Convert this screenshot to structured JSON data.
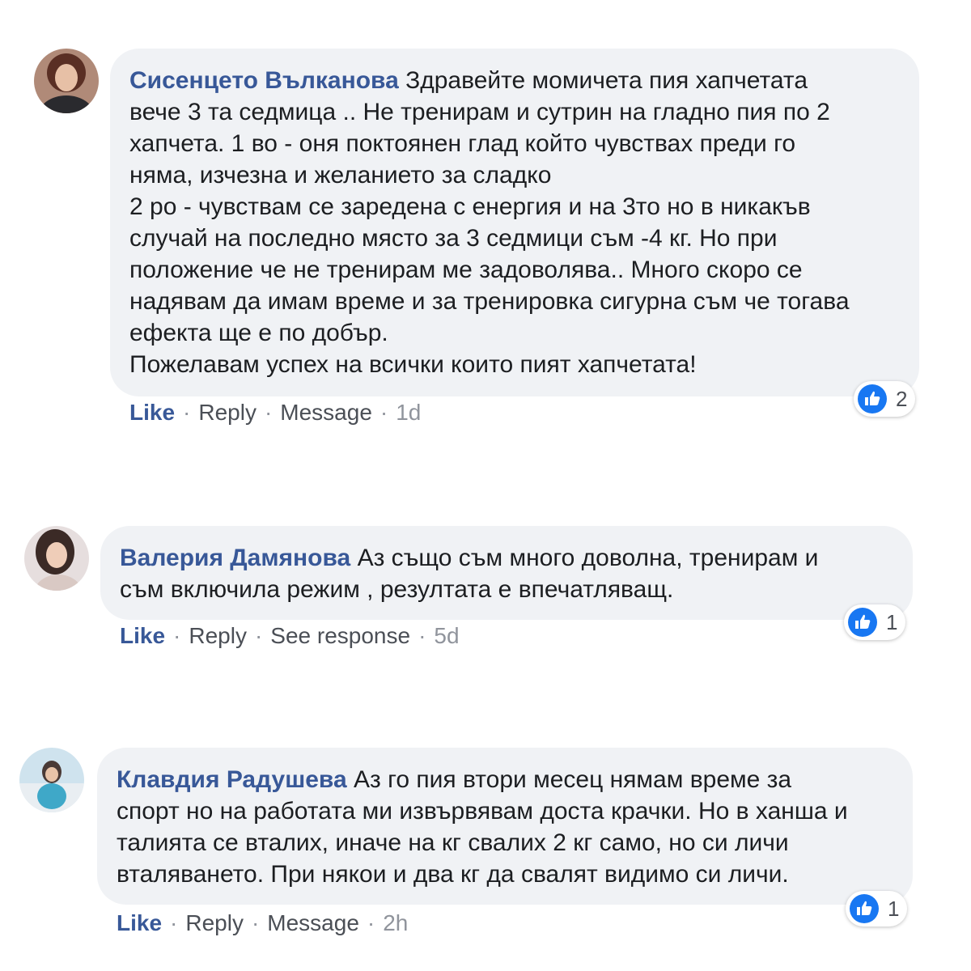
{
  "colors": {
    "author": "#385898",
    "bubble": "#f0f2f5",
    "like_blue": "#1877f2"
  },
  "comments": [
    {
      "author": "Сисенцето Вълканова",
      "lines": [
        " Здравейте момичета пия хапчетата",
        "вече 3 та седмица .. Не тренирам и сутрин на гладно пия по 2",
        "хапчета. 1 во - оня поктоянен глад който чувствах преди го",
        "няма, изчезна и желанието за сладко",
        "2 ро - чувствам се заредена с енергия и на 3то но в никакъв",
        "случай на последно място за 3 седмици съм -4 кг. Но при",
        "положение че не тренирам ме задоволява.. Много скоро се",
        "надявам да имам време и за тренировка сигурна съм че тогава",
        "ефекта ще е по добър.",
        "Пожелавам успех на всички които пият хапчетата!"
      ],
      "actions": {
        "like": "Like",
        "reply": "Reply",
        "extra": "Message",
        "time": "1d"
      },
      "reaction_icon": "thumbs-up-icon",
      "reaction_count": "2"
    },
    {
      "author": "Валерия Дамянова",
      "lines": [
        " Аз също съм много доволна, тренирам и",
        "съм включила режим , резултата е впечатляващ."
      ],
      "actions": {
        "like": "Like",
        "reply": "Reply",
        "extra": "See response",
        "time": "5d"
      },
      "reaction_icon": "thumbs-up-icon",
      "reaction_count": "1"
    },
    {
      "author": "Клавдия Радушева",
      "lines": [
        " Аз го пия втори месец нямам време за",
        "спорт но на работата ми извървявам доста крачки. Но в ханша и",
        "талията се вталих, иначе на кг свалих 2 кг само, но си личи",
        "вталяването. При някои и два кг да свалят видимо си личи."
      ],
      "actions": {
        "like": "Like",
        "reply": "Reply",
        "extra": "Message",
        "time": "2h"
      },
      "reaction_icon": "thumbs-up-icon",
      "reaction_count": "1"
    }
  ]
}
